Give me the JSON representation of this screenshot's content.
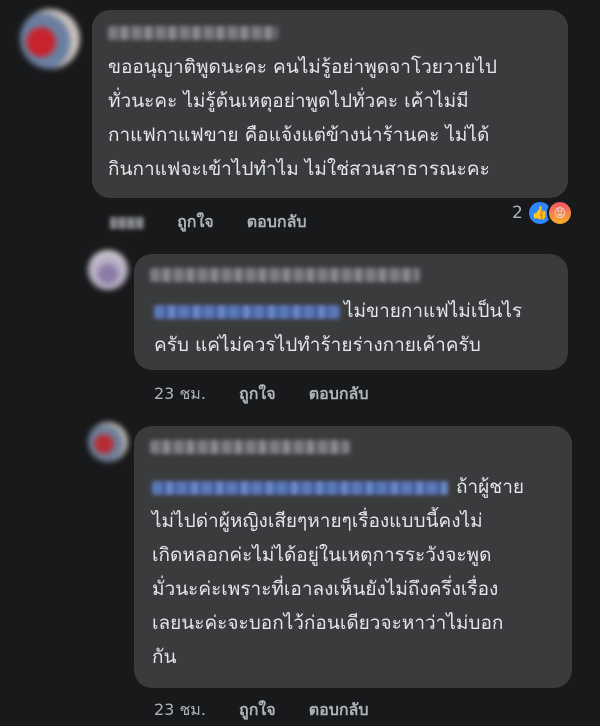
{
  "comments": [
    {
      "text_lines": [
        "ขออนุญาติพูดนะคะ คนไม่รู้อย่าพูดจาโวยวายไป",
        "ทั่วนะคะ ไม่รู้ต้นเหตุอย่าพูดไปทั่วคะ เค้าไม่มี",
        "กาแฟกาแฟขาย คือแจ้งแต่ข้างน่าร้านคะ  ไม่ได้",
        "กินกาแฟจะเข้าไปทำไม ไม่ใช่สวนสาธารณะคะ"
      ],
      "like_label": "ถูกใจ",
      "reply_label": "ตอบกลับ",
      "reaction_count": "2",
      "reaction_icons": [
        "like-icon",
        "angry-icon"
      ]
    },
    {
      "text_lines": [
        "ไม่ขายกาแฟไม่เป็นไร",
        "ครับ แค่ไม่ควรไปทำร้ายร่างกายเค้าครับ"
      ],
      "time": "23 ชม.",
      "like_label": "ถูกใจ",
      "reply_label": "ตอบกลับ"
    },
    {
      "text_lines": [
        "ถ้าผู้ชาย",
        "ไม่ไปด่าผู้หญิงเสียๆหายๆเรื่องแบบนี้คงไม่",
        "เกิดหลอกค่ะไม่ได้อยู่ในเหตุการระวังจะพูด",
        "มั่วนะค่ะเพราะที่เอาลงเห็นยังไม่ถึงครึ่งเรื่อง",
        "เลยนะค่ะจะบอกไว้ก่อนเดียวจะหาว่าไม่บอก",
        "กัน"
      ],
      "time": "23 ชม.",
      "like_label": "ถูกใจ",
      "reply_label": "ตอบกลับ"
    }
  ],
  "colors": {
    "background": "#18191a",
    "bubble": "#3a3b3c",
    "text": "#e4e6eb",
    "meta": "#b0b3b8",
    "like_blue": "#2d88ff"
  }
}
